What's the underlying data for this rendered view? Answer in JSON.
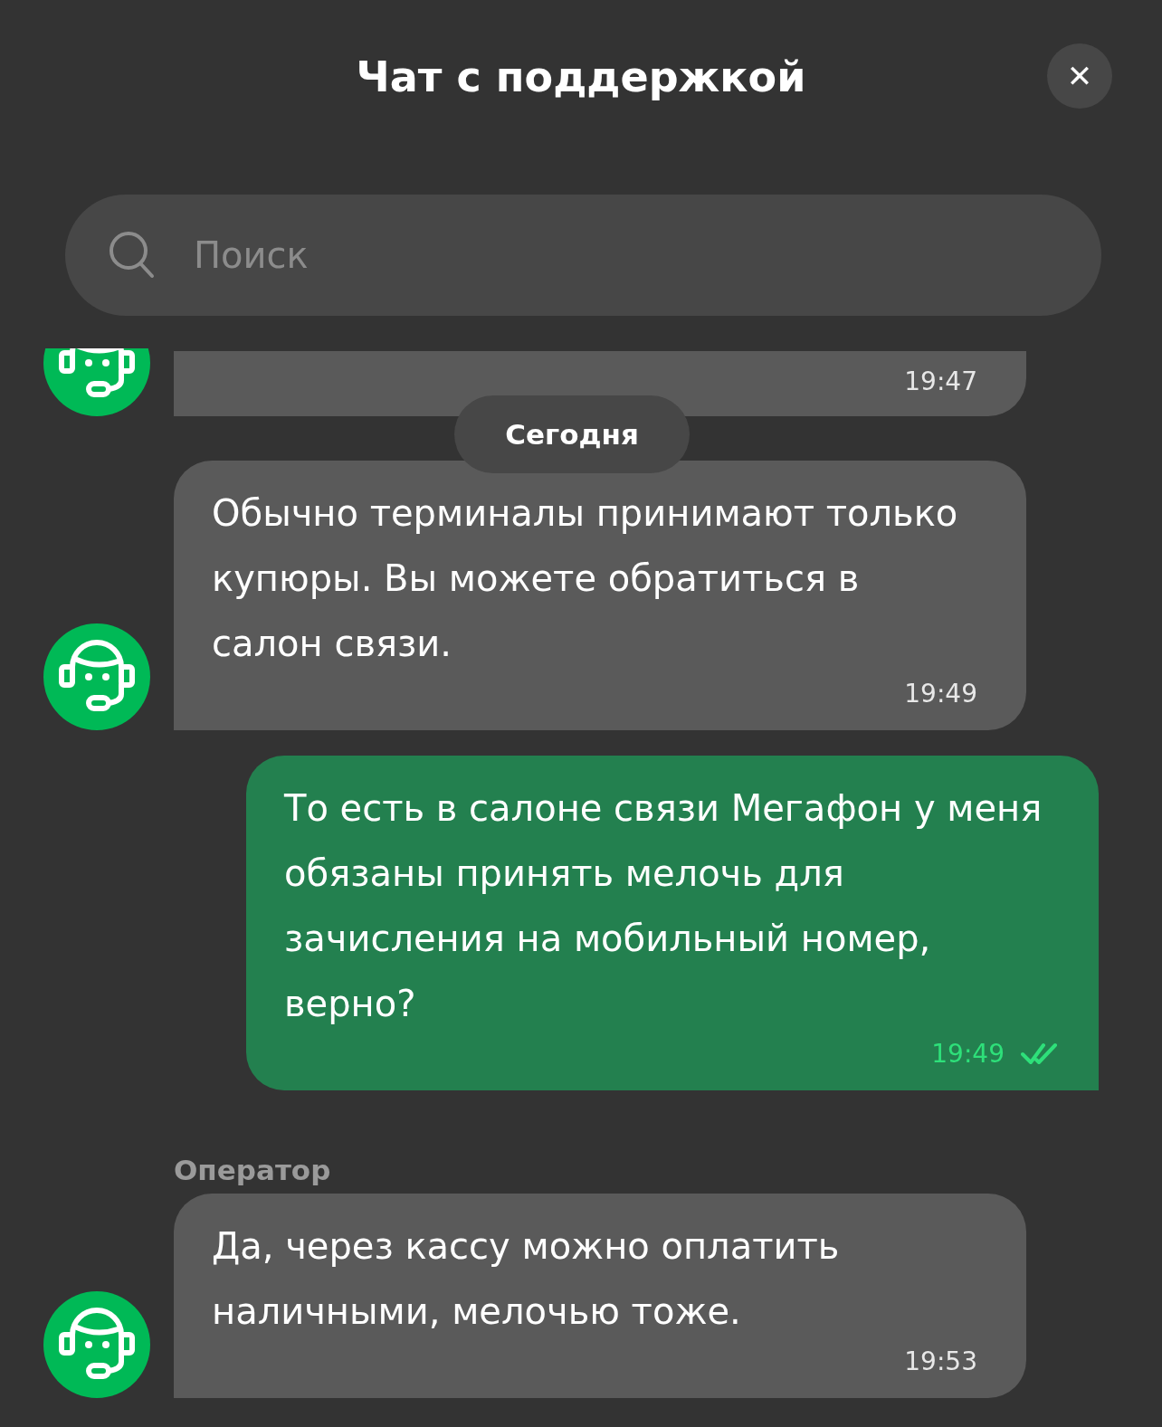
{
  "header": {
    "title": "Чат с поддержкой",
    "close": "✕"
  },
  "search": {
    "placeholder": "Поиск"
  },
  "items": [
    {
      "kind": "incoming",
      "time": "19:47",
      "cut": true
    },
    {
      "kind": "date",
      "label": "Сегодня"
    },
    {
      "kind": "incoming",
      "text": "Обычно терминалы принимают только купюры. Вы можете обратиться в салон связи.",
      "time": "19:49"
    },
    {
      "kind": "outgoing",
      "text": "То есть в салоне связи Мегафон у меня обязаны принять мелочь для зачисления на мобильный номер, верно?",
      "time": "19:49",
      "read": true
    },
    {
      "kind": "incoming",
      "sender": "Оператор",
      "text": "Да, через кассу можно оплатить наличными, мелочью тоже.",
      "time": "19:53"
    }
  ]
}
